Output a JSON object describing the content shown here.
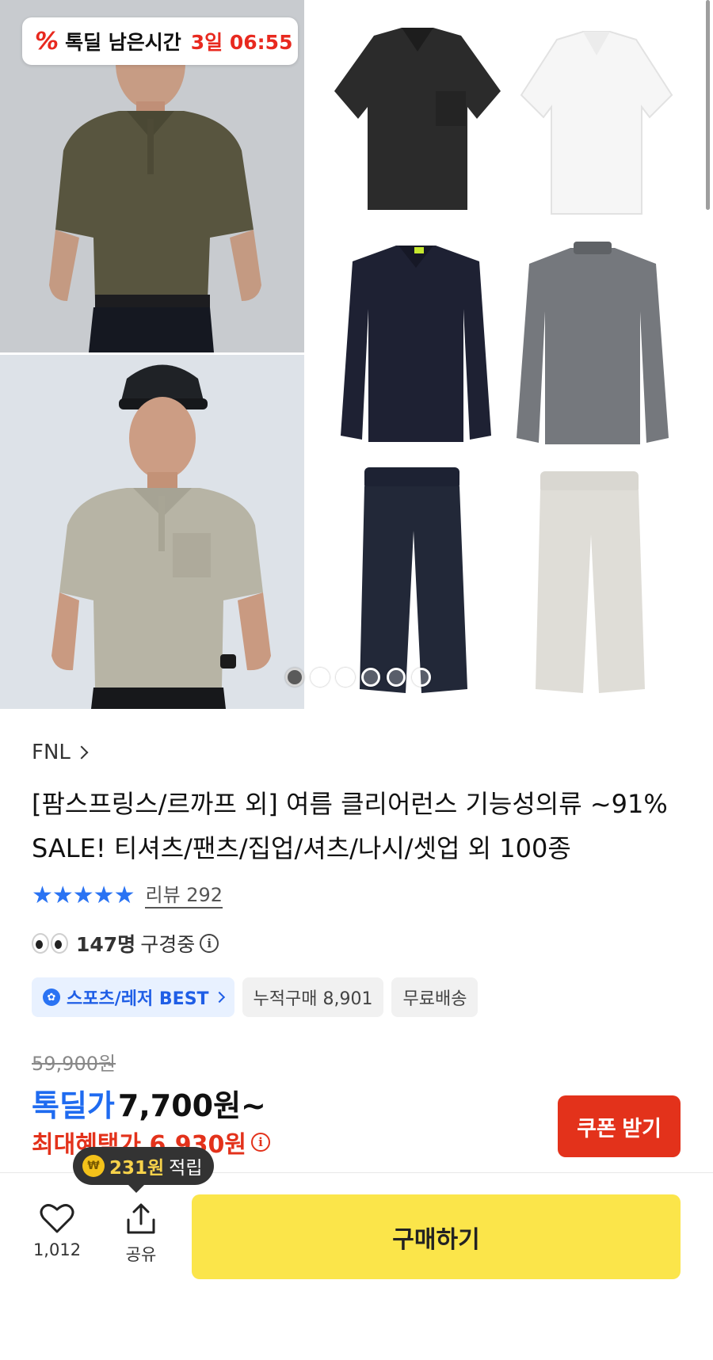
{
  "timer": {
    "label": "톡딜 남은시간",
    "value": "3일 06:55"
  },
  "gallery": {
    "slide_count": 6,
    "active_index": 0
  },
  "product": {
    "brand": "FNL",
    "title": "[팜스프링스/르까프 외] 여름 클리어런스 기능성의류 ~91% SALE! 티셔츠/팬츠/집업/셔츠/나시/셋업 외 100종",
    "rating_stars": 4.5,
    "review_label": "리뷰 292",
    "viewers_count": "147명",
    "viewers_text": "구경중"
  },
  "tags": {
    "best_label": "스포츠/레저 BEST",
    "cumulative_label": "누적구매 8,901",
    "shipping_label": "무료배송"
  },
  "price": {
    "original": "59,900원",
    "deal_label": "톡딜가",
    "deal_price": "7,700원~",
    "max_benefit_label": "최대혜택가 6,930원"
  },
  "coupon": {
    "label": "쿠폰 받기"
  },
  "points": {
    "value": "231원",
    "suffix": "적립"
  },
  "bottom": {
    "like_count": "1,012",
    "share_label": "공유",
    "buy_label": "구매하기"
  },
  "colors": {
    "deal_blue": "#1f6bf0",
    "sale_red": "#e3321b",
    "buy_yellow": "#fbe54a",
    "star_blue": "#2a73f3"
  }
}
